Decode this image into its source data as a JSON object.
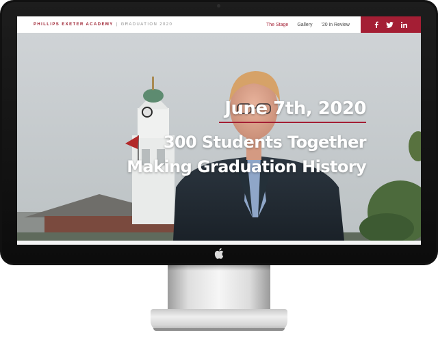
{
  "header": {
    "brand_name": "PHILLIPS EXETER ACADEMY",
    "brand_separator": "|",
    "brand_sub": "GRADUATION 2020",
    "nav": [
      {
        "label": "The Stage",
        "active": true
      },
      {
        "label": "Gallery",
        "active": false
      },
      {
        "label": "'20 in Review",
        "active": false
      }
    ],
    "social": [
      "facebook-icon",
      "twitter-icon",
      "linkedin-icon"
    ]
  },
  "hero": {
    "date": "June 7th, 2020",
    "line1": "300 Students Together",
    "line2": "Making Graduation History"
  },
  "colors": {
    "accent": "#a41e34",
    "bezel": "#111111"
  }
}
